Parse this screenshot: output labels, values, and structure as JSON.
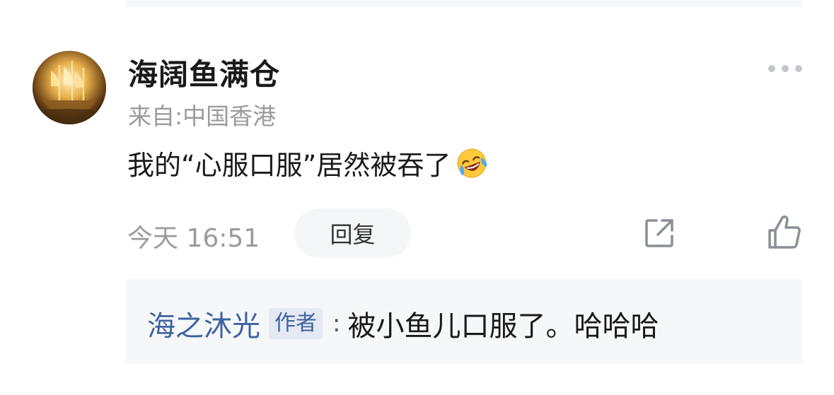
{
  "comment": {
    "username": "海阔鱼满仓",
    "location": "来自:中国香港",
    "text": "我的“心服口服”居然被吞了",
    "emoji_icon": "laughing-crying-emoji",
    "timestamp": "今天 16:51",
    "reply_label": "回复",
    "share_icon": "share-icon",
    "like_icon": "thumbs-up-icon",
    "more_icon": "more-dots-icon"
  },
  "sub_reply": {
    "author": "海之沐光",
    "author_tag": "作者",
    "separator": ":",
    "text": "被小鱼儿口服了。哈哈哈"
  },
  "colors": {
    "username": "#1a1a1a",
    "secondary_text": "#9b9b9b",
    "link_blue": "#3f63a0",
    "reply_bg": "#f5f6f8",
    "sub_reply_bg": "#f6f7f9"
  }
}
